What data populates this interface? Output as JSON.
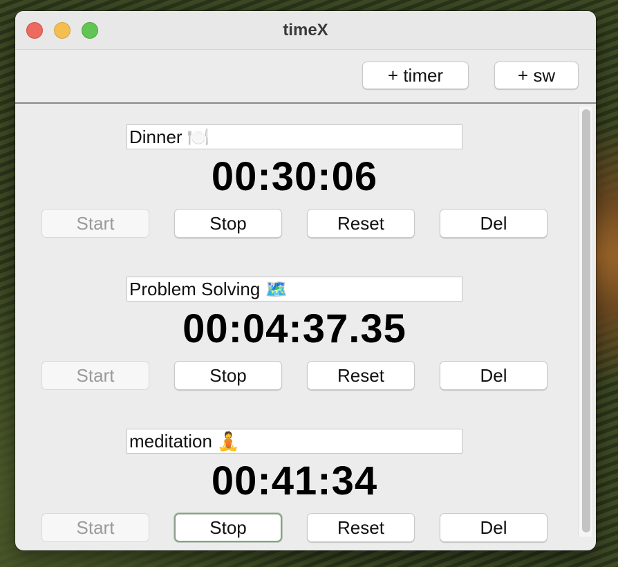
{
  "window": {
    "title": "timeX"
  },
  "toolbar": {
    "add_timer_label": "+ timer",
    "add_stopwatch_label": "+ sw"
  },
  "timers": [
    {
      "name": "Dinner 🍽️",
      "time": "00:30:06",
      "start_label": "Start",
      "stop_label": "Stop",
      "reset_label": "Reset",
      "delete_label": "Del"
    },
    {
      "name": "Problem Solving 🗺️",
      "time": "00:04:37.35",
      "start_label": "Start",
      "stop_label": "Stop",
      "reset_label": "Reset",
      "delete_label": "Del"
    },
    {
      "name": "meditation 🧘",
      "time": "00:41:34",
      "start_label": "Start",
      "stop_label": "Stop",
      "reset_label": "Reset",
      "delete_label": "Del"
    }
  ],
  "colors": {
    "close": "#ed6a5e",
    "minimize": "#f5bf4f",
    "maximize": "#61c554",
    "window_bg": "#ececec",
    "disabled_text": "#9a9a9a"
  }
}
